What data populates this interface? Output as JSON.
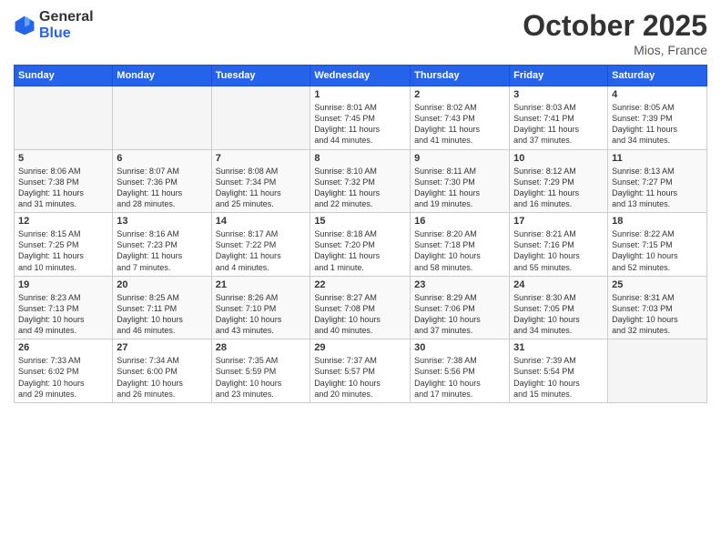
{
  "header": {
    "logo_general": "General",
    "logo_blue": "Blue",
    "month_title": "October 2025",
    "location": "Mios, France"
  },
  "days_of_week": [
    "Sunday",
    "Monday",
    "Tuesday",
    "Wednesday",
    "Thursday",
    "Friday",
    "Saturday"
  ],
  "weeks": [
    [
      {
        "num": "",
        "info": ""
      },
      {
        "num": "",
        "info": ""
      },
      {
        "num": "",
        "info": ""
      },
      {
        "num": "1",
        "info": "Sunrise: 8:01 AM\nSunset: 7:45 PM\nDaylight: 11 hours\nand 44 minutes."
      },
      {
        "num": "2",
        "info": "Sunrise: 8:02 AM\nSunset: 7:43 PM\nDaylight: 11 hours\nand 41 minutes."
      },
      {
        "num": "3",
        "info": "Sunrise: 8:03 AM\nSunset: 7:41 PM\nDaylight: 11 hours\nand 37 minutes."
      },
      {
        "num": "4",
        "info": "Sunrise: 8:05 AM\nSunset: 7:39 PM\nDaylight: 11 hours\nand 34 minutes."
      }
    ],
    [
      {
        "num": "5",
        "info": "Sunrise: 8:06 AM\nSunset: 7:38 PM\nDaylight: 11 hours\nand 31 minutes."
      },
      {
        "num": "6",
        "info": "Sunrise: 8:07 AM\nSunset: 7:36 PM\nDaylight: 11 hours\nand 28 minutes."
      },
      {
        "num": "7",
        "info": "Sunrise: 8:08 AM\nSunset: 7:34 PM\nDaylight: 11 hours\nand 25 minutes."
      },
      {
        "num": "8",
        "info": "Sunrise: 8:10 AM\nSunset: 7:32 PM\nDaylight: 11 hours\nand 22 minutes."
      },
      {
        "num": "9",
        "info": "Sunrise: 8:11 AM\nSunset: 7:30 PM\nDaylight: 11 hours\nand 19 minutes."
      },
      {
        "num": "10",
        "info": "Sunrise: 8:12 AM\nSunset: 7:29 PM\nDaylight: 11 hours\nand 16 minutes."
      },
      {
        "num": "11",
        "info": "Sunrise: 8:13 AM\nSunset: 7:27 PM\nDaylight: 11 hours\nand 13 minutes."
      }
    ],
    [
      {
        "num": "12",
        "info": "Sunrise: 8:15 AM\nSunset: 7:25 PM\nDaylight: 11 hours\nand 10 minutes."
      },
      {
        "num": "13",
        "info": "Sunrise: 8:16 AM\nSunset: 7:23 PM\nDaylight: 11 hours\nand 7 minutes."
      },
      {
        "num": "14",
        "info": "Sunrise: 8:17 AM\nSunset: 7:22 PM\nDaylight: 11 hours\nand 4 minutes."
      },
      {
        "num": "15",
        "info": "Sunrise: 8:18 AM\nSunset: 7:20 PM\nDaylight: 11 hours\nand 1 minute."
      },
      {
        "num": "16",
        "info": "Sunrise: 8:20 AM\nSunset: 7:18 PM\nDaylight: 10 hours\nand 58 minutes."
      },
      {
        "num": "17",
        "info": "Sunrise: 8:21 AM\nSunset: 7:16 PM\nDaylight: 10 hours\nand 55 minutes."
      },
      {
        "num": "18",
        "info": "Sunrise: 8:22 AM\nSunset: 7:15 PM\nDaylight: 10 hours\nand 52 minutes."
      }
    ],
    [
      {
        "num": "19",
        "info": "Sunrise: 8:23 AM\nSunset: 7:13 PM\nDaylight: 10 hours\nand 49 minutes."
      },
      {
        "num": "20",
        "info": "Sunrise: 8:25 AM\nSunset: 7:11 PM\nDaylight: 10 hours\nand 46 minutes."
      },
      {
        "num": "21",
        "info": "Sunrise: 8:26 AM\nSunset: 7:10 PM\nDaylight: 10 hours\nand 43 minutes."
      },
      {
        "num": "22",
        "info": "Sunrise: 8:27 AM\nSunset: 7:08 PM\nDaylight: 10 hours\nand 40 minutes."
      },
      {
        "num": "23",
        "info": "Sunrise: 8:29 AM\nSunset: 7:06 PM\nDaylight: 10 hours\nand 37 minutes."
      },
      {
        "num": "24",
        "info": "Sunrise: 8:30 AM\nSunset: 7:05 PM\nDaylight: 10 hours\nand 34 minutes."
      },
      {
        "num": "25",
        "info": "Sunrise: 8:31 AM\nSunset: 7:03 PM\nDaylight: 10 hours\nand 32 minutes."
      }
    ],
    [
      {
        "num": "26",
        "info": "Sunrise: 7:33 AM\nSunset: 6:02 PM\nDaylight: 10 hours\nand 29 minutes."
      },
      {
        "num": "27",
        "info": "Sunrise: 7:34 AM\nSunset: 6:00 PM\nDaylight: 10 hours\nand 26 minutes."
      },
      {
        "num": "28",
        "info": "Sunrise: 7:35 AM\nSunset: 5:59 PM\nDaylight: 10 hours\nand 23 minutes."
      },
      {
        "num": "29",
        "info": "Sunrise: 7:37 AM\nSunset: 5:57 PM\nDaylight: 10 hours\nand 20 minutes."
      },
      {
        "num": "30",
        "info": "Sunrise: 7:38 AM\nSunset: 5:56 PM\nDaylight: 10 hours\nand 17 minutes."
      },
      {
        "num": "31",
        "info": "Sunrise: 7:39 AM\nSunset: 5:54 PM\nDaylight: 10 hours\nand 15 minutes."
      },
      {
        "num": "",
        "info": ""
      }
    ]
  ]
}
